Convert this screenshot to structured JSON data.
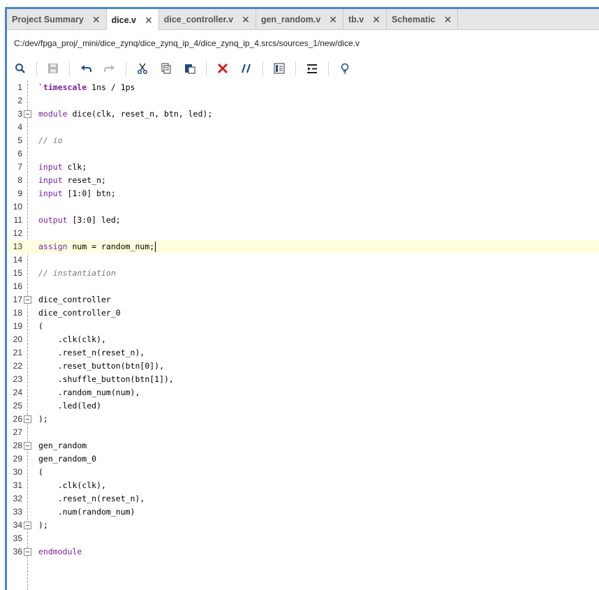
{
  "tabs": [
    {
      "label": "Project Summary",
      "active": false
    },
    {
      "label": "dice.v",
      "active": true
    },
    {
      "label": "dice_controller.v",
      "active": false
    },
    {
      "label": "gen_random.v",
      "active": false
    },
    {
      "label": "tb.v",
      "active": false
    },
    {
      "label": "Schematic",
      "active": false
    }
  ],
  "file_path": "C:/dev/fpga_proj/_mini/dice_zynq/dice_zynq_ip_4/dice_zynq_ip_4.srcs/sources_1/new/dice.v",
  "toolbar": [
    "search-icon",
    "save-icon",
    "undo-icon",
    "redo-icon",
    "cut-icon",
    "copy-icon",
    "paste-icon",
    "delete-icon",
    "comment-icon",
    "block-comment-icon",
    "indent-icon",
    "lightbulb-icon"
  ],
  "editor": {
    "current_line": 13,
    "lines": [
      {
        "n": "1",
        "text": "`timescale 1ns / 1ps",
        "type": "directive"
      },
      {
        "n": "2",
        "text": "",
        "type": "plain"
      },
      {
        "n": "3",
        "text": "module dice(clk, reset_n, btn, led);",
        "type": "module",
        "fold": true
      },
      {
        "n": "4",
        "text": "",
        "type": "plain"
      },
      {
        "n": "5",
        "text": "// io",
        "type": "comment"
      },
      {
        "n": "6",
        "text": "",
        "type": "plain"
      },
      {
        "n": "7",
        "text": "input clk;",
        "type": "kwline",
        "kw": "input"
      },
      {
        "n": "8",
        "text": "input reset_n;",
        "type": "kwline",
        "kw": "input"
      },
      {
        "n": "9",
        "text": "input [1:0] btn;",
        "type": "kwline",
        "kw": "input"
      },
      {
        "n": "10",
        "text": "",
        "type": "plain"
      },
      {
        "n": "11",
        "text": "output [3:0] led;",
        "type": "kwline",
        "kw": "output"
      },
      {
        "n": "12",
        "text": "",
        "type": "plain"
      },
      {
        "n": "13",
        "text": "assign num = random_num;",
        "type": "kwline",
        "kw": "assign"
      },
      {
        "n": "14",
        "text": "",
        "type": "plain"
      },
      {
        "n": "15",
        "text": "// instantiation",
        "type": "comment"
      },
      {
        "n": "16",
        "text": "",
        "type": "plain"
      },
      {
        "n": "17",
        "text": "dice_controller",
        "type": "plain",
        "fold": true
      },
      {
        "n": "18",
        "text": "dice_controller_0",
        "type": "plain"
      },
      {
        "n": "19",
        "text": "(",
        "type": "plain"
      },
      {
        "n": "20",
        "text": "    .clk(clk),",
        "type": "plain"
      },
      {
        "n": "21",
        "text": "    .reset_n(reset_n),",
        "type": "plain"
      },
      {
        "n": "22",
        "text": "    .reset_button(btn[0]),",
        "type": "plain"
      },
      {
        "n": "23",
        "text": "    .shuffle_button(btn[1]),",
        "type": "plain"
      },
      {
        "n": "24",
        "text": "    .random_num(num),",
        "type": "plain"
      },
      {
        "n": "25",
        "text": "    .led(led)",
        "type": "plain"
      },
      {
        "n": "26",
        "text": ");",
        "type": "plain",
        "fold": true
      },
      {
        "n": "27",
        "text": "",
        "type": "plain"
      },
      {
        "n": "28",
        "text": "gen_random",
        "type": "plain",
        "fold": true
      },
      {
        "n": "29",
        "text": "gen_random_0",
        "type": "plain"
      },
      {
        "n": "30",
        "text": "(",
        "type": "plain"
      },
      {
        "n": "31",
        "text": "    .clk(clk),",
        "type": "plain"
      },
      {
        "n": "32",
        "text": "    .reset_n(reset_n),",
        "type": "plain"
      },
      {
        "n": "33",
        "text": "    .num(random_num)",
        "type": "plain"
      },
      {
        "n": "34",
        "text": ");",
        "type": "plain",
        "fold": true
      },
      {
        "n": "35",
        "text": "",
        "type": "plain"
      },
      {
        "n": "36",
        "text": "endmodule",
        "type": "kwline",
        "kw": "endmodule",
        "fold": true
      }
    ]
  },
  "colors": {
    "accent": "#4a86c8",
    "keyword": "#7b1fa2",
    "comment": "#7a7a7a",
    "current_line": "#ffffe0"
  }
}
